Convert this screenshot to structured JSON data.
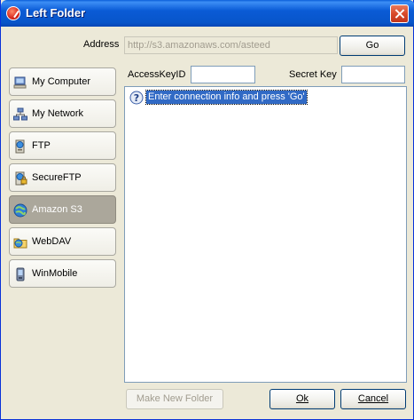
{
  "window": {
    "title": "Left Folder"
  },
  "address": {
    "label": "Address",
    "value": "http://s3.amazonaws.com/asteed",
    "go_label": "Go"
  },
  "credentials": {
    "access_key_label": "AccessKeyID",
    "access_key_value": "",
    "secret_key_label": "Secret Key",
    "secret_key_value": ""
  },
  "sidebar": {
    "items": [
      {
        "label": "My Computer",
        "icon": "computer-icon",
        "selected": false
      },
      {
        "label": "My Network",
        "icon": "network-icon",
        "selected": false
      },
      {
        "label": "FTP",
        "icon": "ftp-icon",
        "selected": false
      },
      {
        "label": "SecureFTP",
        "icon": "secure-ftp-icon",
        "selected": false
      },
      {
        "label": "Amazon S3",
        "icon": "amazon-s3-icon",
        "selected": true
      },
      {
        "label": "WebDAV",
        "icon": "webdav-icon",
        "selected": false
      },
      {
        "label": "WinMobile",
        "icon": "winmobile-icon",
        "selected": false
      }
    ]
  },
  "tree": {
    "items": [
      {
        "label": "Enter connection info and press 'Go'",
        "icon": "help-icon",
        "selected": true
      }
    ]
  },
  "footer": {
    "new_folder_label": "Make New Folder",
    "ok_label": "Ok",
    "cancel_label": "Cancel"
  },
  "colors": {
    "titlebar": "#0a5bd6",
    "selection": "#316ac5",
    "selected_item": "#aba79b",
    "window_bg": "#ece9d8"
  }
}
